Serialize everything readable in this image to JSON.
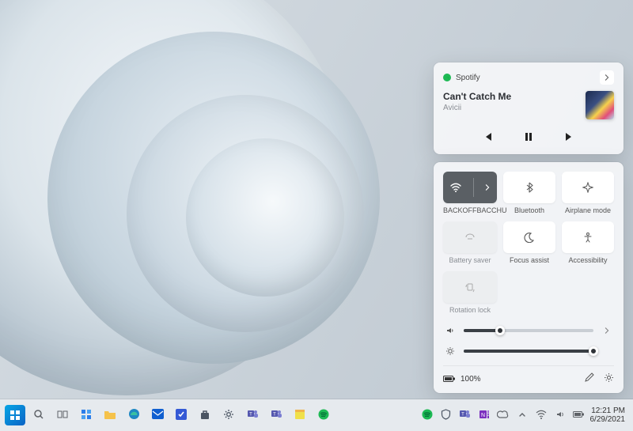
{
  "media": {
    "app_name": "Spotify",
    "track_title": "Can't Catch Me",
    "artist": "Avicii",
    "controls": {
      "prev": "previous",
      "playpause": "pause",
      "next": "next"
    }
  },
  "quick_settings": {
    "tiles": [
      {
        "id": "wifi",
        "label": "BACKOFFBACCHU",
        "active": true,
        "has_chevron": true
      },
      {
        "id": "bluetooth",
        "label": "Bluetooth",
        "active": false
      },
      {
        "id": "airplane",
        "label": "Airplane mode",
        "active": false
      },
      {
        "id": "battery-saver",
        "label": "Battery saver",
        "active": false,
        "muted": true
      },
      {
        "id": "focus-assist",
        "label": "Focus assist",
        "active": false
      },
      {
        "id": "accessibility",
        "label": "Accessibility",
        "active": false
      },
      {
        "id": "rotation-lock",
        "label": "Rotation lock",
        "active": false,
        "muted": true
      }
    ],
    "volume_percent": 28,
    "brightness_percent": 100,
    "battery_text": "100%"
  },
  "taskbar": {
    "time": "12:21 PM",
    "date": "6/29/2021",
    "pinned": [
      {
        "id": "start",
        "icon": "start-icon",
        "color": "#1389d1"
      },
      {
        "id": "search",
        "icon": "search-icon",
        "color": "#5f6368"
      },
      {
        "id": "task-view",
        "icon": "taskview-icon",
        "color": "#5f6368"
      },
      {
        "id": "widgets",
        "icon": "widgets-icon",
        "color": "#2b7de9"
      },
      {
        "id": "file-explorer",
        "icon": "folder-icon",
        "color": "#f5c24b"
      },
      {
        "id": "edge",
        "icon": "edge-icon",
        "color": "#1e88c3"
      },
      {
        "id": "mail",
        "icon": "mail-icon",
        "color": "#0f5fd0"
      },
      {
        "id": "todo",
        "icon": "todo-icon",
        "color": "#3459d5"
      },
      {
        "id": "store",
        "icon": "store-icon",
        "color": "#4b5563"
      },
      {
        "id": "settings",
        "icon": "settings-icon",
        "color": "#4b5563"
      },
      {
        "id": "teams-personal",
        "icon": "teams-icon",
        "color": "#5558af"
      },
      {
        "id": "teams-work",
        "icon": "teams-icon",
        "color": "#5558af"
      },
      {
        "id": "sticky-notes",
        "icon": "note-icon",
        "color": "#f0b44a"
      },
      {
        "id": "spotify-taskbar",
        "icon": "spotify-icon",
        "color": "#1db954"
      }
    ],
    "tray": [
      {
        "id": "tray-spotify",
        "icon": "spotify-icon",
        "color": "#1db954"
      },
      {
        "id": "tray-security",
        "icon": "shield-icon",
        "color": "#4b5563"
      },
      {
        "id": "tray-teams",
        "icon": "teams-icon",
        "color": "#5558af"
      },
      {
        "id": "tray-onenote",
        "icon": "onenote-icon",
        "color": "#7b2fbf"
      },
      {
        "id": "tray-onedrive",
        "icon": "cloud-icon",
        "color": "#5f6368"
      },
      {
        "id": "tray-overflow",
        "icon": "chevron-up-icon",
        "color": "#5f6368"
      },
      {
        "id": "tray-network",
        "icon": "wifi-icon",
        "color": "#5f6368"
      },
      {
        "id": "tray-volume",
        "icon": "speaker-icon",
        "color": "#5f6368"
      },
      {
        "id": "tray-battery",
        "icon": "battery-icon",
        "color": "#5f6368"
      }
    ]
  }
}
